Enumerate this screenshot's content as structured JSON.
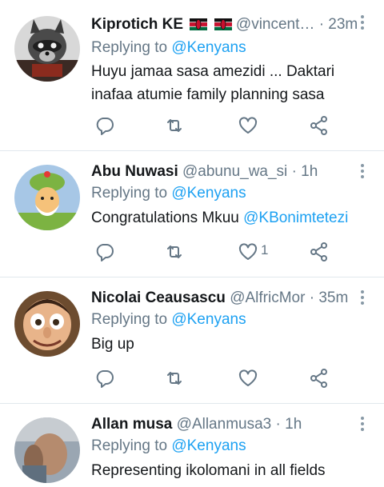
{
  "tweets": [
    {
      "name": "Kiprotich KE",
      "handle": "@vincent…",
      "dot": "·",
      "time": "23m",
      "replying_prefix": "Replying to",
      "replying_to": "@Kenyans",
      "text": "Huyu jamaa sasa amezidi ... Daktari inafaa atumie family planning sasa",
      "flags": [
        "kenya-flag",
        "kenya-flag"
      ],
      "likes": ""
    },
    {
      "name": "Abu Nuwasi",
      "handle": "@abunu_wa_si",
      "dot": "·",
      "time": "1h",
      "replying_prefix": "Replying to",
      "replying_to": "@Kenyans",
      "text_before": "Congratulations Mkuu ",
      "text_mention": "@KBonimtetezi",
      "likes": "1"
    },
    {
      "name": "Nicolai Ceausascu",
      "handle": "@AlfricMor",
      "dot": "·",
      "time": "35m",
      "replying_prefix": "Replying to",
      "replying_to": "@Kenyans",
      "text": "Big up",
      "likes": ""
    },
    {
      "name": "Allan musa",
      "handle": "@Allanmusa3",
      "dot": "·",
      "time": "1h",
      "replying_prefix": "Replying to",
      "replying_to": "@Kenyans",
      "text": "Representing ikolomani in all fields"
    }
  ],
  "colors": {
    "text": "#14171a",
    "secondary": "#657786",
    "link": "#1da1f2",
    "divider": "#e1e8ed"
  },
  "icons": [
    "reply-icon",
    "retweet-icon",
    "like-icon",
    "share-icon",
    "more-icon",
    "kenya-flag"
  ]
}
